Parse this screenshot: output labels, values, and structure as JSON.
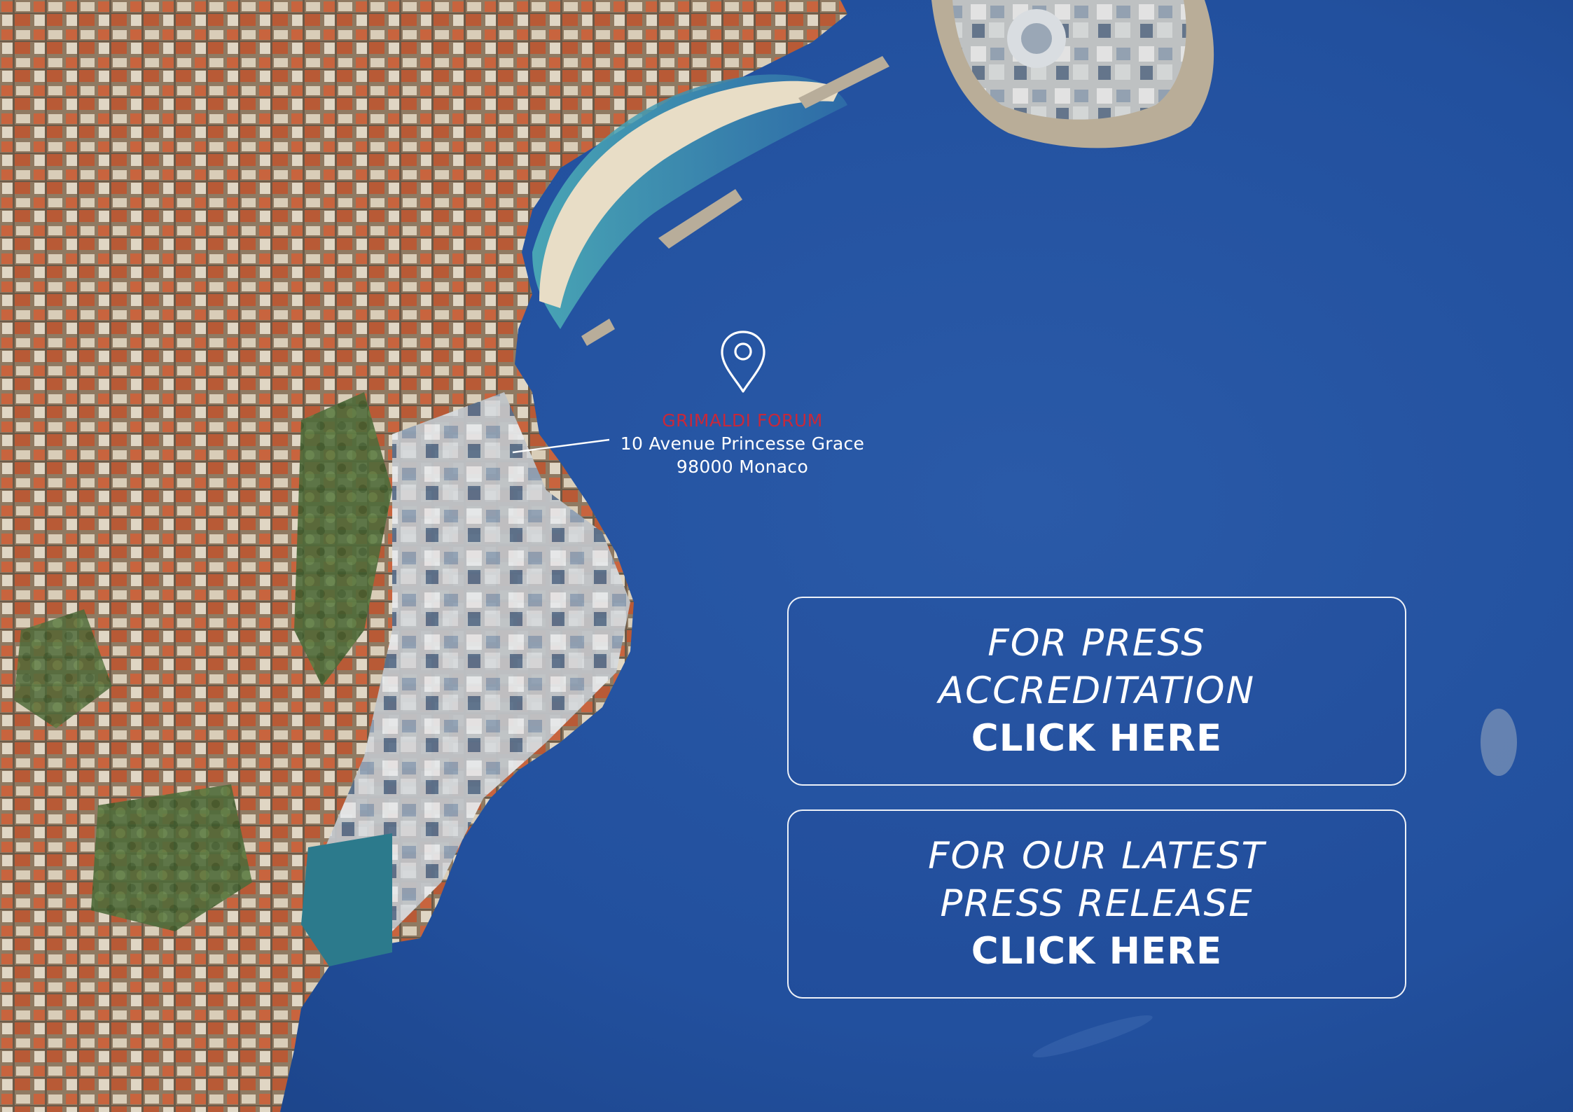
{
  "location": {
    "marker_icon": "map-pin-icon",
    "venue": "GRIMALDI FORUM",
    "address_line1": "10 Avenue Princesse Grace",
    "address_line2": "98000 Monaco",
    "venue_color": "#c8283a"
  },
  "cta_accreditation": {
    "line1": "FOR PRESS",
    "line2": "ACCREDITATION",
    "action": "CLICK HERE"
  },
  "cta_press_release": {
    "line1": "FOR OUR LATEST",
    "line2": "PRESS RELEASE",
    "action": "CLICK HERE"
  },
  "colors": {
    "sea": "#1f4a94",
    "panel_border": "#ffffff",
    "text": "#ffffff"
  }
}
